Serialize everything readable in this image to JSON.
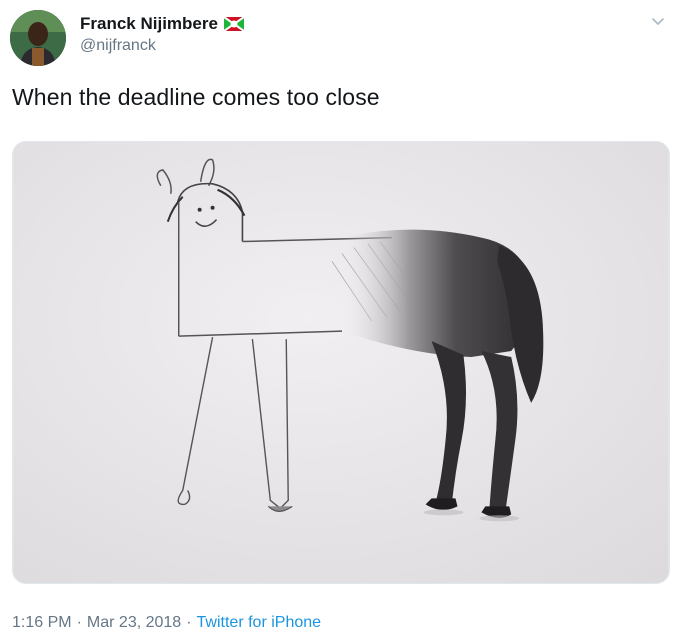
{
  "tweet": {
    "author": {
      "display_name": "Franck Nijimbere",
      "handle": "@nijfranck",
      "flag_icon": "burundi-flag-icon"
    },
    "text": "When the deadline comes too close",
    "media": {
      "subject": "horse drawing"
    },
    "meta": {
      "time": "1:16 PM",
      "separator": "·",
      "date": "Mar 23, 2018",
      "source": "Twitter for iPhone"
    },
    "menu_icon": "chevron-down-icon"
  },
  "colors": {
    "text": "#14171a",
    "secondary": "#657786",
    "link": "#1b95e0",
    "border": "#e1e8ed"
  }
}
